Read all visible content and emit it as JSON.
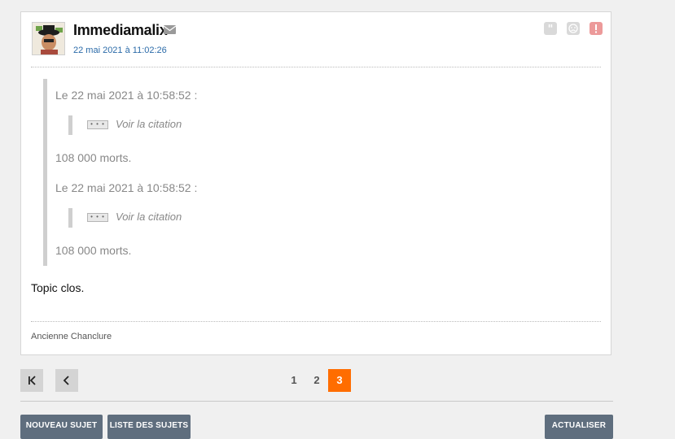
{
  "post": {
    "author": "Immediamalix",
    "date": "22 mai 2021 à 11:02:26",
    "quotes": [
      {
        "header": "Le 22 mai 2021 à 10:58:52 :",
        "view_quote_label": "Voir la citation",
        "body": "108 000 morts."
      },
      {
        "header": "Le 22 mai 2021 à 10:58:52 :",
        "view_quote_label": "Voir la citation",
        "body": "108 000 morts."
      }
    ],
    "message": "Topic clos.",
    "signature": "Ancienne Chanclure",
    "dots": "• • •"
  },
  "pagination": {
    "pages": [
      "1",
      "2",
      "3"
    ],
    "current": "3"
  },
  "actions": {
    "new_topic": "NOUVEAU SUJET",
    "topic_list": "LISTE DES SUJETS",
    "refresh": "ACTUALISER"
  },
  "colors": {
    "accent": "#ff6d00",
    "date_link": "#2a6aa8",
    "button": "#5f6e7e",
    "alert": "#e87070"
  }
}
